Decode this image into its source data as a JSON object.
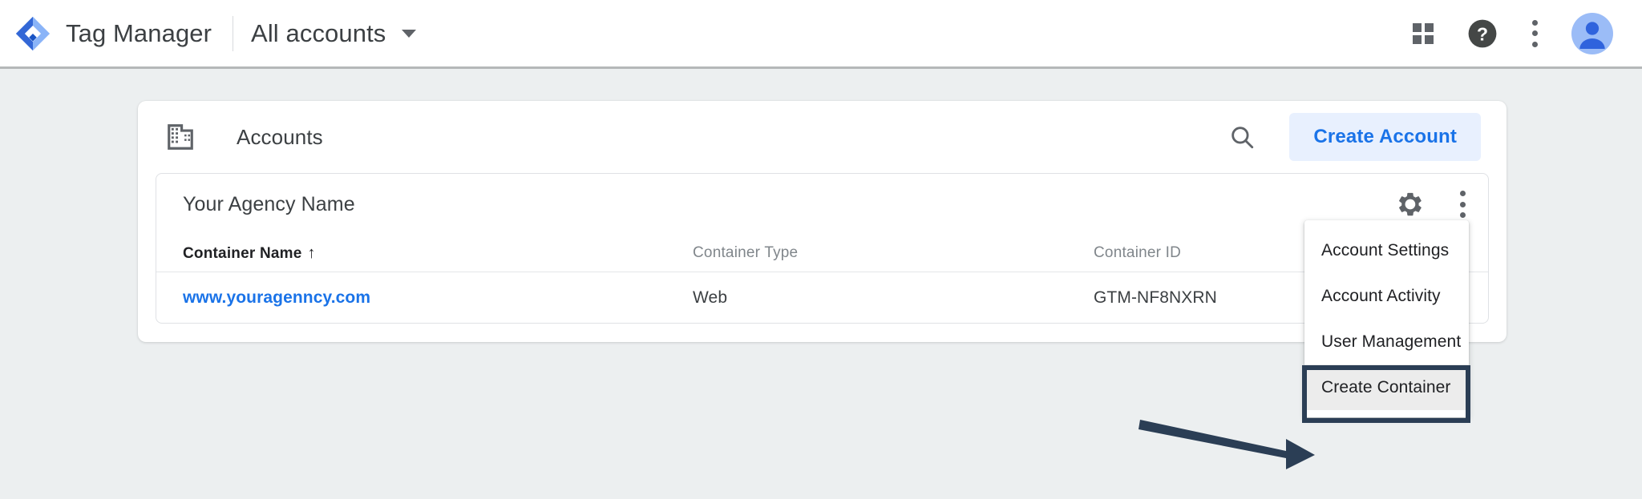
{
  "appbar": {
    "logo_icon": "tag-manager-logo-icon",
    "product_title": "Tag Manager",
    "account_switcher_label": "All accounts",
    "caret_icon": "chevron-down-icon",
    "apps_icon": "apps-grid-icon",
    "help_icon": "help-circle-icon",
    "more_icon": "kebab-menu-icon",
    "avatar_icon": "user-avatar-icon"
  },
  "accounts_card": {
    "header_icon": "building-icon",
    "title": "Accounts",
    "search_icon": "search-icon",
    "create_account_label": "Create Account"
  },
  "account": {
    "name": "Your Agency Name",
    "settings_icon": "gear-icon",
    "more_icon": "kebab-menu-icon"
  },
  "containers_table": {
    "columns": [
      {
        "label": "Container Name",
        "sorted": true,
        "sort_arrow": "↑"
      },
      {
        "label": "Container Type",
        "sorted": false,
        "sort_arrow": ""
      },
      {
        "label": "Container ID",
        "sorted": false,
        "sort_arrow": ""
      }
    ],
    "rows": [
      {
        "name": "www.youragenncy.com",
        "type": "Web",
        "id": "GTM-NF8NXRN"
      }
    ]
  },
  "dropdown_menu": {
    "items": [
      {
        "label": "Account Settings",
        "highlighted": false
      },
      {
        "label": "Account Activity",
        "highlighted": false
      },
      {
        "label": "User Management",
        "highlighted": false
      },
      {
        "label": "Create Container",
        "highlighted": true
      }
    ]
  },
  "annotation": {
    "arrow_icon": "arrow-right-annotation-icon",
    "arrow_color": "#2b3e55",
    "highlight_box_color": "#2b3e55"
  },
  "colors": {
    "page_background": "#eceff0",
    "card_background": "#ffffff",
    "accent_blue": "#1a73e8",
    "accent_blue_light": "#e8f0fe",
    "text_primary": "#3c4043",
    "text_secondary": "#80868b"
  }
}
